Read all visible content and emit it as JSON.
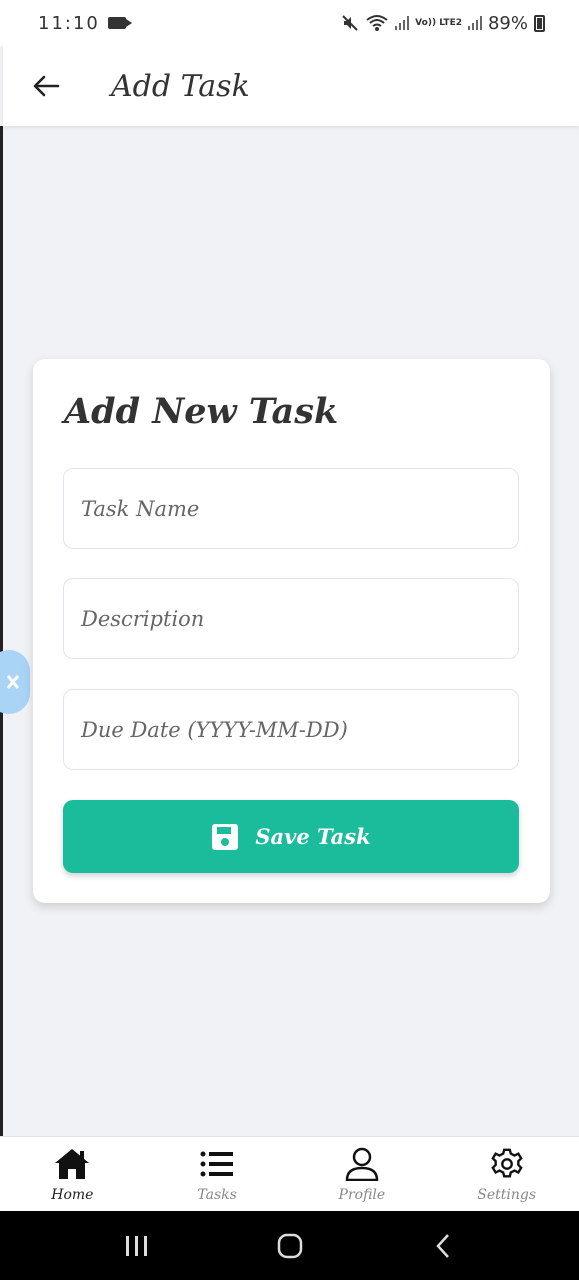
{
  "status_bar": {
    "time": "11:10",
    "volte": "Vo)) LTE2",
    "battery": "89%"
  },
  "app_bar": {
    "title": "Add Task",
    "back_icon": "arrow-left-icon"
  },
  "form": {
    "heading": "Add New Task",
    "task_name_placeholder": "Task Name",
    "description_placeholder": "Description",
    "due_date_placeholder": "Due Date (YYYY-MM-DD)",
    "save_label": "Save Task",
    "save_icon": "floppy-disk-icon",
    "accent_color": "#1abc9c"
  },
  "bottom_nav": {
    "items": [
      {
        "label": "Home",
        "icon": "home-icon",
        "active": true
      },
      {
        "label": "Tasks",
        "icon": "list-icon",
        "active": false
      },
      {
        "label": "Profile",
        "icon": "user-icon",
        "active": false
      },
      {
        "label": "Settings",
        "icon": "gear-icon",
        "active": false
      }
    ]
  },
  "system_nav": {
    "recents_icon": "recents-icon",
    "home_icon": "home-circle-icon",
    "back_icon": "back-chevron-icon"
  }
}
